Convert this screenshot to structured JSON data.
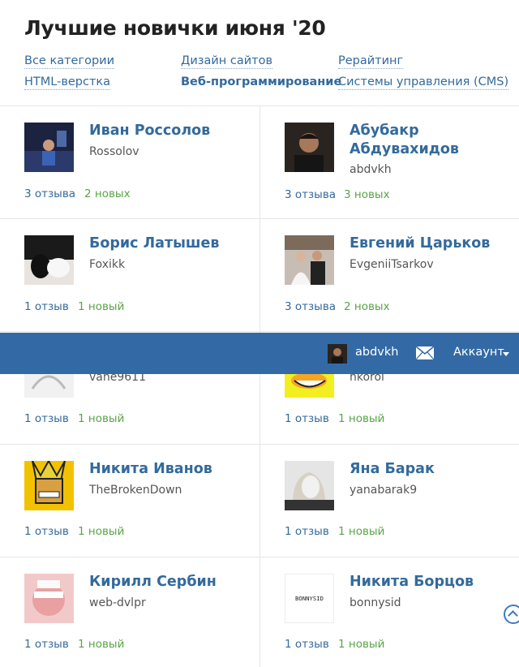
{
  "page": {
    "title": "Лучшие новички июня '20"
  },
  "categories": {
    "all": "Все категории",
    "web_design": "Дизайн сайтов",
    "rewriting": "Рерайтинг",
    "html": "HTML-верстка",
    "web_dev": "Веб-программирование",
    "cms": "Системы управления (CMS)"
  },
  "topbar": {
    "username": "abdvkh",
    "account_label": "Аккаунт"
  },
  "users": [
    {
      "name": "Иван Россолов",
      "login": "Rossolov",
      "reviews": "3 отзыва",
      "new": "2 новых"
    },
    {
      "name": "Абубакр Абдувахидов",
      "login": "abdvkh",
      "reviews": "3 отзыва",
      "new": "3 новых"
    },
    {
      "name": "Борис Латышев",
      "login": "Foxikk",
      "reviews": "1 отзыв",
      "new": "1 новый"
    },
    {
      "name": "Евгений Царьков",
      "login": "EvgeniiTsarkov",
      "reviews": "3 отзыва",
      "new": "2 новых"
    },
    {
      "name": "",
      "login": "vahe9611",
      "reviews": "1 отзыв",
      "new": "1 новый"
    },
    {
      "name": "",
      "login": "nkorol",
      "reviews": "1 отзыв",
      "new": "1 новый"
    },
    {
      "name": "Никита Иванов",
      "login": "TheBrokenDown",
      "reviews": "1 отзыв",
      "new": "1 новый"
    },
    {
      "name": "Яна Барак",
      "login": "yanabarak9",
      "reviews": "1 отзыв",
      "new": "1 новый"
    },
    {
      "name": "Кирилл Сербин",
      "login": "web-dvlpr",
      "reviews": "1 отзыв",
      "new": "1 новый"
    },
    {
      "name": "Никита Борцов",
      "login": "bonnysid",
      "reviews": "1 отзыв",
      "new": "1 новый",
      "avatar_text": "BONNYSID"
    }
  ]
}
